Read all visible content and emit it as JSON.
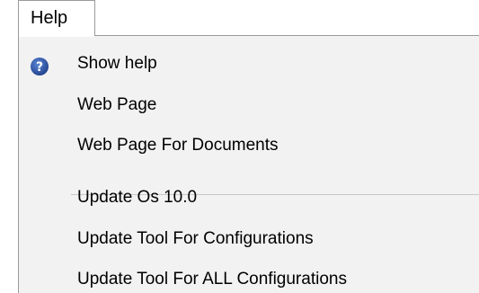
{
  "menubar": {
    "title": "Help"
  },
  "menu": {
    "items": [
      {
        "label": "Show help",
        "icon": "help-question-icon"
      },
      {
        "label": "Web Page"
      },
      {
        "label": "Web Page For Documents"
      },
      {
        "label": "Update Os 10.0"
      },
      {
        "label": "Update Tool For Configurations"
      },
      {
        "label": "Update Tool For ALL Configurations"
      }
    ]
  },
  "colors": {
    "help_icon": "#1f4ea3",
    "menu_background": "#f2f2f2",
    "border": "#9a9a9a"
  }
}
